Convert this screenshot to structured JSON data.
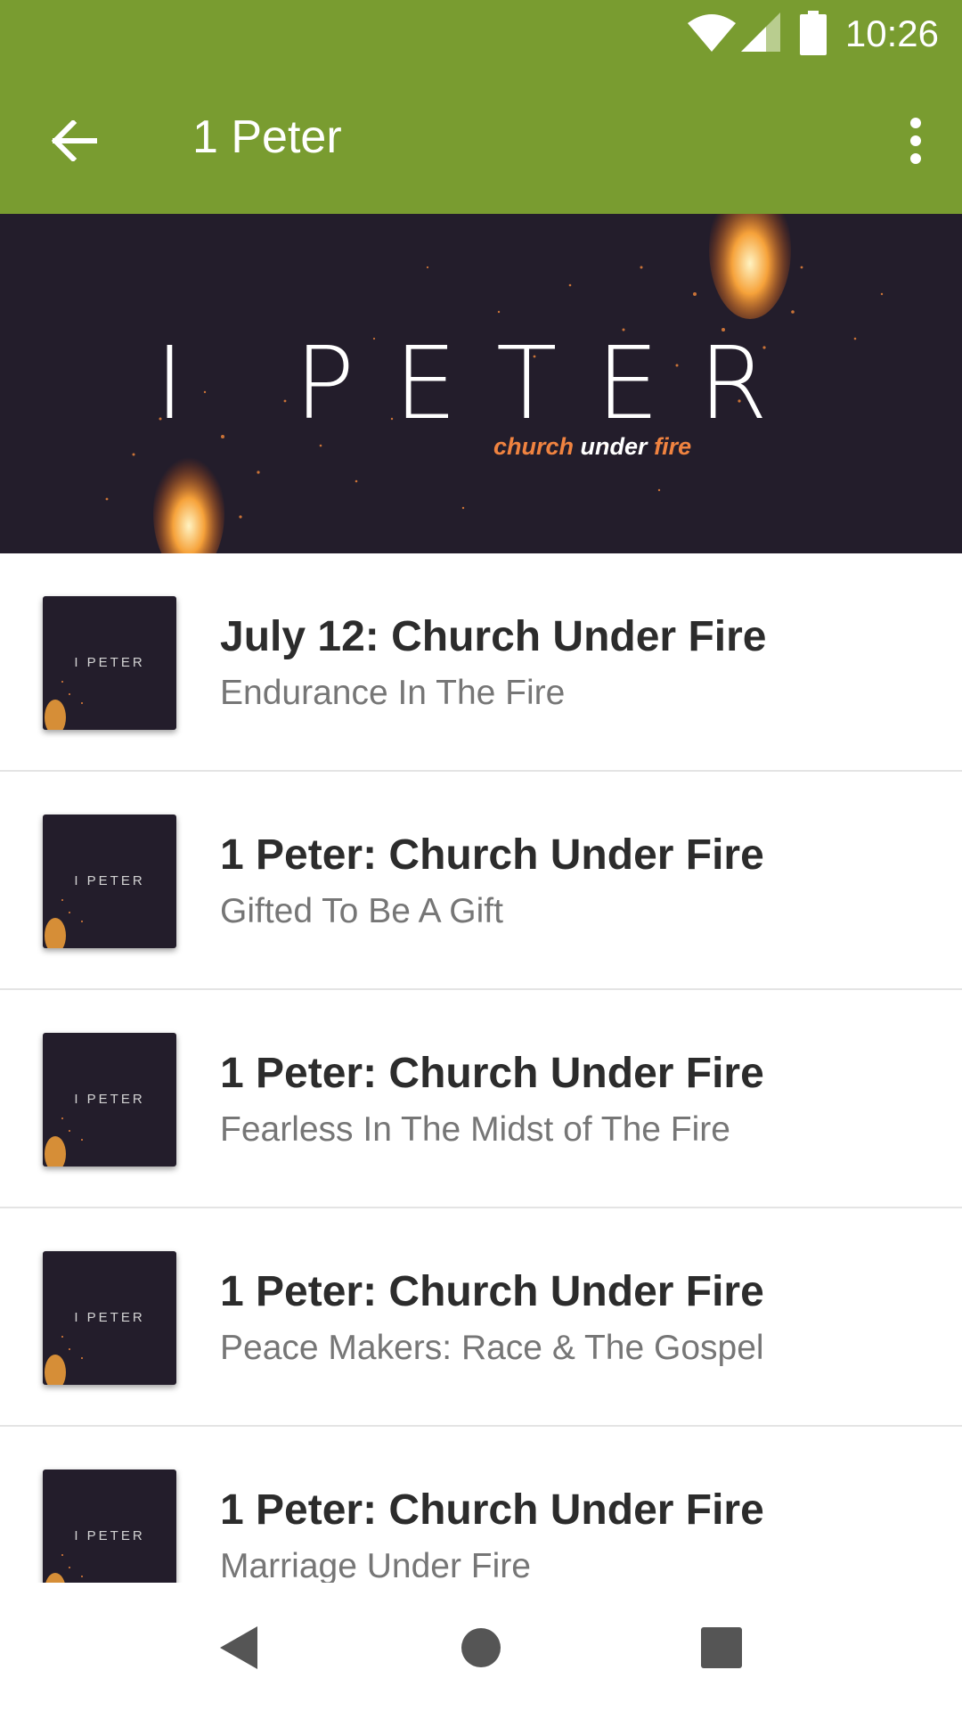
{
  "status_bar": {
    "time": "10:26"
  },
  "toolbar": {
    "title": "1 Peter"
  },
  "banner": {
    "title": "I PETER",
    "subtitle_part1": "church",
    "subtitle_part2": "under",
    "subtitle_part3": "fire"
  },
  "thumbnail": {
    "label": "I PETER"
  },
  "sermons": [
    {
      "title": "July 12: Church Under Fire",
      "subtitle": "Endurance In The Fire"
    },
    {
      "title": "1 Peter: Church Under Fire",
      "subtitle": "Gifted To Be A Gift"
    },
    {
      "title": "1 Peter: Church Under Fire",
      "subtitle": "Fearless In The Midst of The Fire"
    },
    {
      "title": "1 Peter: Church Under Fire",
      "subtitle": "Peace Makers: Race & The Gospel"
    },
    {
      "title": "1 Peter: Church Under Fire",
      "subtitle": "Marriage Under Fire"
    }
  ],
  "colors": {
    "accent": "#799c30",
    "banner_bg": "#231d2b",
    "fire": "#f08340"
  },
  "icons": {
    "back": "arrow-back-icon",
    "menu": "more-vert-icon",
    "wifi": "wifi-icon",
    "signal": "signal-icon",
    "battery": "battery-icon",
    "nav_back": "nav-back-icon",
    "nav_home": "nav-home-icon",
    "nav_recents": "nav-recents-icon"
  }
}
